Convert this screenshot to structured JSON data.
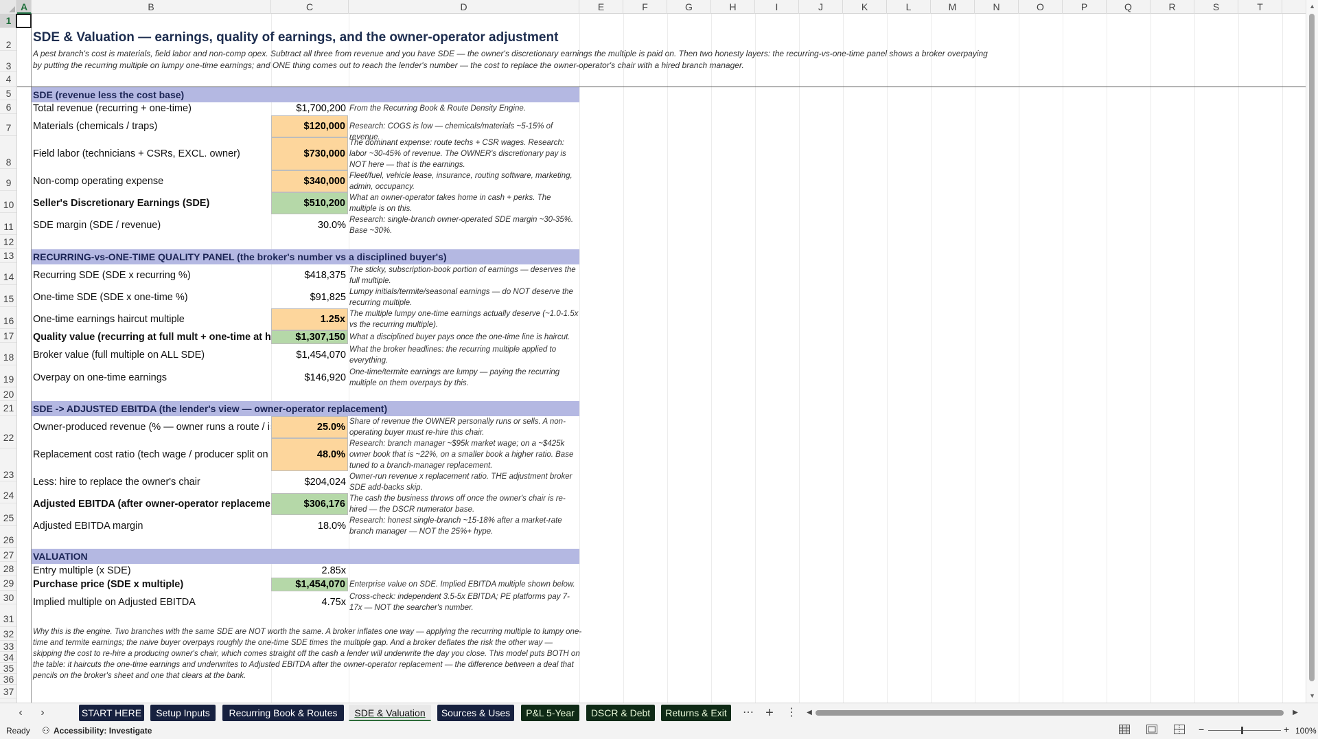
{
  "columns": [
    "A",
    "B",
    "C",
    "D",
    "E",
    "F",
    "G",
    "H",
    "I",
    "J",
    "K",
    "L",
    "M",
    "N",
    "O",
    "P",
    "Q",
    "R",
    "S",
    "T"
  ],
  "rows": [
    "1",
    "2",
    "3",
    "4",
    "5",
    "6",
    "7",
    "8",
    "9",
    "10",
    "11",
    "12",
    "13",
    "14",
    "15",
    "16",
    "17",
    "18",
    "19",
    "20",
    "21",
    "22",
    "23",
    "24",
    "25",
    "26",
    "27",
    "28",
    "29",
    "30",
    "31",
    "32",
    "33",
    "34",
    "35",
    "36",
    "37"
  ],
  "sheet": {
    "title": "SDE & Valuation — earnings, quality of earnings, and the owner-operator adjustment",
    "subtitle": "A pest branch's cost is materials, field labor and non-comp opex. Subtract all three from revenue and you have SDE — the owner's discretionary earnings the multiple is paid on. Then two honesty layers: the recurring-vs-one-time panel shows a broker overpaying by putting the recurring multiple on lumpy one-time earnings; and ONE thing comes out to reach the lender's number — the cost to replace the owner-operator's chair with a hired branch manager.",
    "sections": {
      "sde": "SDE  (revenue less the cost base)",
      "quality": "RECURRING-vs-ONE-TIME QUALITY PANEL  (the broker's number vs a disciplined buyer's)",
      "ebitda": "SDE -> ADJUSTED EBITDA  (the lender's view — owner-operator replacement)",
      "valuation": "VALUATION"
    },
    "lines": {
      "r6": {
        "label": "Total revenue (recurring + one-time)",
        "value": "$1,700,200",
        "note": "From the Recurring Book & Route Density Engine."
      },
      "r7": {
        "label": "Materials (chemicals / traps)",
        "value": "$120,000",
        "note": "Research: COGS is low — chemicals/materials ~5-15% of revenue."
      },
      "r8": {
        "label": "Field labor (technicians + CSRs, EXCL. owner)",
        "value": "$730,000",
        "note": "The dominant expense: route techs + CSR wages. Research: labor ~30-45% of revenue. The OWNER's discretionary pay is NOT here — that is the earnings."
      },
      "r9": {
        "label": "Non-comp operating expense",
        "value": "$340,000",
        "note": "Fleet/fuel, vehicle lease, insurance, routing software, marketing, admin, occupancy."
      },
      "r10": {
        "label": "Seller's Discretionary Earnings (SDE)",
        "value": "$510,200",
        "note": "What an owner-operator takes home in cash + perks. The multiple is on this."
      },
      "r11": {
        "label": "SDE margin (SDE / revenue)",
        "value": "30.0%",
        "note": "Research: single-branch owner-operated SDE margin ~30-35%. Base ~30%."
      },
      "r14": {
        "label": "Recurring SDE (SDE x recurring %)",
        "value": "$418,375",
        "note": "The sticky, subscription-book portion of earnings — deserves the full multiple."
      },
      "r15": {
        "label": "One-time SDE (SDE x one-time %)",
        "value": "$91,825",
        "note": "Lumpy initials/termite/seasonal earnings — do NOT deserve the recurring multiple."
      },
      "r16": {
        "label": "One-time earnings haircut multiple",
        "value": "1.25x",
        "note": "The multiple lumpy one-time earnings actually deserve (~1.0-1.5x vs the recurring multiple)."
      },
      "r17": {
        "label": "Quality value (recurring at full mult + one-time at haircut)",
        "value": "$1,307,150",
        "note": "What a disciplined buyer pays once the one-time line is haircut."
      },
      "r18": {
        "label": "Broker value (full multiple on ALL SDE)",
        "value": "$1,454,070",
        "note": "What the broker headlines: the recurring multiple applied to everything."
      },
      "r19": {
        "label": "Overpay on one-time earnings",
        "value": "$146,920",
        "note": "One-time/termite earnings are lumpy — paying the recurring multiple on them overpays by this."
      },
      "r22": {
        "label": "Owner-produced revenue (% — owner runs a route / is the producer)",
        "value": "25.0%",
        "note": "Share of revenue the OWNER personally runs or sells. A non-operating buyer must re-hire this chair."
      },
      "r23": {
        "label": "Replacement cost ratio (tech wage / producer split on owner book)",
        "value": "48.0%",
        "note": "Research: branch manager ~$95k market wage; on a ~$425k owner book that is ~22%, on a smaller book a higher ratio. Base tuned to a branch-manager replacement."
      },
      "r24": {
        "label": "Less: hire to replace the owner's chair",
        "value": "$204,024",
        "note": "Owner-run revenue x replacement ratio. THE adjustment broker SDE add-backs skip."
      },
      "r25": {
        "label": "Adjusted EBITDA (after owner-operator replacement)",
        "value": "$306,176",
        "note": "The cash the business throws off once the owner's chair is re-hired — the DSCR numerator base."
      },
      "r26": {
        "label": "Adjusted EBITDA margin",
        "value": "18.0%",
        "note": "Research: honest single-branch ~15-18% after a market-rate branch manager — NOT the 25%+ hype."
      },
      "r29": {
        "label": "Entry multiple (x SDE)",
        "value": "2.85x",
        "note": ""
      },
      "r30": {
        "label": "Purchase price (SDE x multiple)",
        "value": "$1,454,070",
        "note": "Enterprise value on SDE. Implied EBITDA multiple shown below."
      },
      "r31": {
        "label": "Implied multiple on Adjusted EBITDA",
        "value": "4.75x",
        "note": "Cross-check: independent 3.5-5x EBITDA; PE platforms pay 7-17x — NOT the searcher's number."
      }
    },
    "paragraph": "Why this is the engine. Two branches with the same SDE are NOT worth the same. A broker inflates one way — applying the recurring multiple to lumpy one-time and termite earnings; the naive buyer overpays roughly the one-time SDE times the multiple gap. And a broker deflates the risk the other way — skipping the cost to re-hire a producing owner's chair, which comes straight off the cash a lender will underwrite the day you close. This model puts BOTH on the table: it haircuts the one-time earnings and underwrites to Adjusted EBITDA after the owner-operator replacement — the difference between a deal that pencils on the broker's sheet and one that clears at the bank."
  },
  "tabs": [
    "START HERE",
    "Setup Inputs",
    "Recurring Book & Routes",
    "SDE & Valuation",
    "Sources & Uses",
    "P&L 5-Year",
    "DSCR & Debt",
    "Returns & Exit"
  ],
  "active_tab": "SDE & Valuation",
  "status": {
    "ready": "Ready",
    "accessibility": "Accessibility: Investigate",
    "zoom": "100%"
  },
  "colors": {
    "section_band": "#b4b8e2",
    "input_cell": "#fdd69c",
    "result_cell": "#b5d8a8",
    "tab_navy": "#17213f",
    "tab_green": "#0f2a16"
  }
}
